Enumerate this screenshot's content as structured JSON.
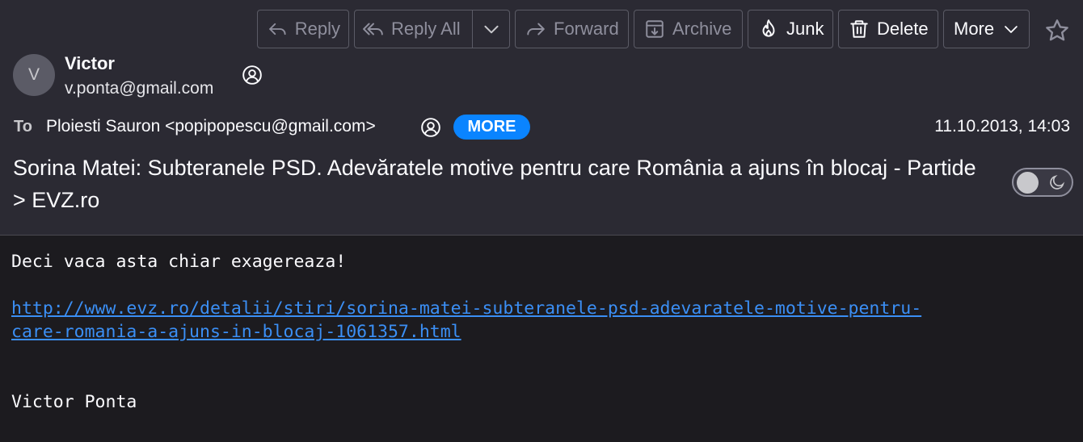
{
  "toolbar": {
    "reply": "Reply",
    "reply_all": "Reply All",
    "forward": "Forward",
    "archive": "Archive",
    "junk": "Junk",
    "delete": "Delete",
    "more": "More"
  },
  "sender": {
    "avatar_initial": "V",
    "name": "Victor",
    "email": "v.ponta@gmail.com"
  },
  "recipients": {
    "label": "To",
    "value": "Ploiesti Sauron <popipopescu@gmail.com>",
    "more_label": "MORE"
  },
  "date": "11.10.2013, 14:03",
  "subject": "Sorina Matei: Subteranele PSD. Adevăratele motive pentru care România a ajuns în blocaj - Partide > EVZ.ro",
  "message": {
    "greeting": "Deci vaca asta chiar exagereaza!",
    "link_line1": "http://www.evz.ro/detalii/stiri/sorina-matei-subteranele-psd-adevaratele-motive-pentru-",
    "link_line2": "care-romania-a-ajuns-in-blocaj-1061357.html",
    "signature": "Victor Ponta"
  },
  "colors": {
    "accent": "#0a84ff",
    "link": "#3b8ff5",
    "header_bg": "#2b2a33",
    "body_bg": "#1c1b1f"
  }
}
